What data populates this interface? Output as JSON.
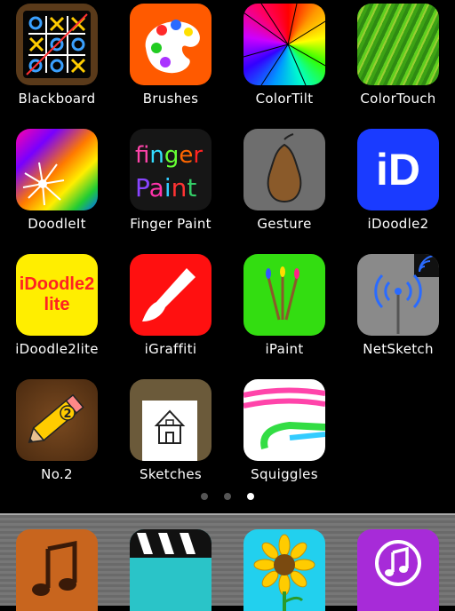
{
  "home": {
    "apps": [
      {
        "label": "Blackboard",
        "icon": "blackboard-icon"
      },
      {
        "label": "Brushes",
        "icon": "brushes-icon"
      },
      {
        "label": "ColorTilt",
        "icon": "colortilt-icon"
      },
      {
        "label": "ColorTouch",
        "icon": "colortouch-icon"
      },
      {
        "label": "DoodleIt",
        "icon": "doodleit-icon"
      },
      {
        "label": "Finger Paint",
        "icon": "fingerpaint-icon",
        "icon_text": [
          "finger",
          "Paint"
        ]
      },
      {
        "label": "Gesture",
        "icon": "gesture-icon"
      },
      {
        "label": "iDoodle2",
        "icon": "idoodle2-icon",
        "icon_text": "iD"
      },
      {
        "label": "iDoodle2lite",
        "icon": "idoodle2lite-icon",
        "icon_text": [
          "iDoodle2",
          "lite"
        ]
      },
      {
        "label": "iGraffiti",
        "icon": "igraffiti-icon"
      },
      {
        "label": "iPaint",
        "icon": "ipaint-icon"
      },
      {
        "label": "NetSketch",
        "icon": "netsketch-icon"
      },
      {
        "label": "No.2",
        "icon": "no2-pencil-icon",
        "icon_text": "2"
      },
      {
        "label": "Sketches",
        "icon": "sketches-icon"
      },
      {
        "label": "Squiggles",
        "icon": "squiggles-icon"
      }
    ],
    "page_indicator": {
      "count": 3,
      "active": 3
    }
  },
  "dock": {
    "apps": [
      {
        "icon": "music-icon"
      },
      {
        "icon": "videos-icon"
      },
      {
        "icon": "sunflower-photos-icon"
      },
      {
        "icon": "itunes-icon"
      }
    ]
  },
  "colors": {
    "brushes": "#ff5a00",
    "idoodle2": "#1a3bff",
    "idoodle2lite": "#ffee00",
    "igraffiti": "#ff1010",
    "ipaint": "#33dd11",
    "netsketch": "#8a8a8a"
  }
}
